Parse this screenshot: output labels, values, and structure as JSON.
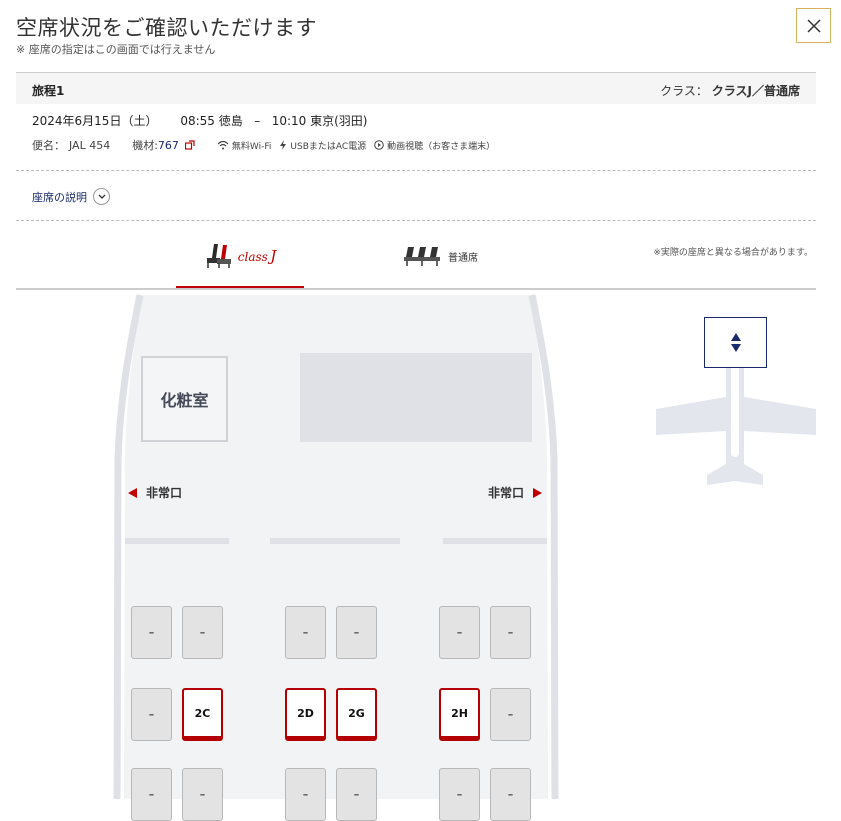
{
  "header": {
    "title": "空席状況をご確認いただけます",
    "note": "※ 座席の指定はこの画面では行えません"
  },
  "itinerary": {
    "label": "旅程1",
    "class_prefix": "クラス：",
    "class_value": "クラスJ／普通席",
    "date": "2024年6月15日（土）",
    "dep_time": "08:55",
    "dep_airport": "徳島",
    "separator": "–",
    "arr_time": "10:10",
    "arr_airport": "東京(羽田)",
    "flight_label": "便名：",
    "flight_no": "JAL 454",
    "aircraft_label": "機材:",
    "aircraft_value": "767",
    "amenities": [
      "無料Wi-Fi",
      "USBまたはAC電源",
      "動画視聴（お客さま端末）"
    ]
  },
  "seat_description": "座席の説明",
  "tabs": [
    {
      "label": "class",
      "label_j": "J"
    },
    {
      "label": "普通席"
    }
  ],
  "disclaimer": "※実際の座席と異なる場合があります。",
  "cabin": {
    "lavatory": "化粧室",
    "exit_left": "非常口",
    "exit_right": "非常口",
    "unavailable_mark": "–",
    "rows": [
      [
        "–",
        "–",
        "–",
        "–",
        "–",
        "–"
      ],
      [
        "–",
        "2C",
        "2D",
        "2G",
        "2H",
        "–"
      ],
      [
        "–",
        "–",
        "–",
        "–",
        "–",
        "–"
      ]
    ]
  },
  "colors": {
    "accent": "#c00000",
    "navy": "#1a2a6c",
    "close_border": "#d8b25c"
  }
}
